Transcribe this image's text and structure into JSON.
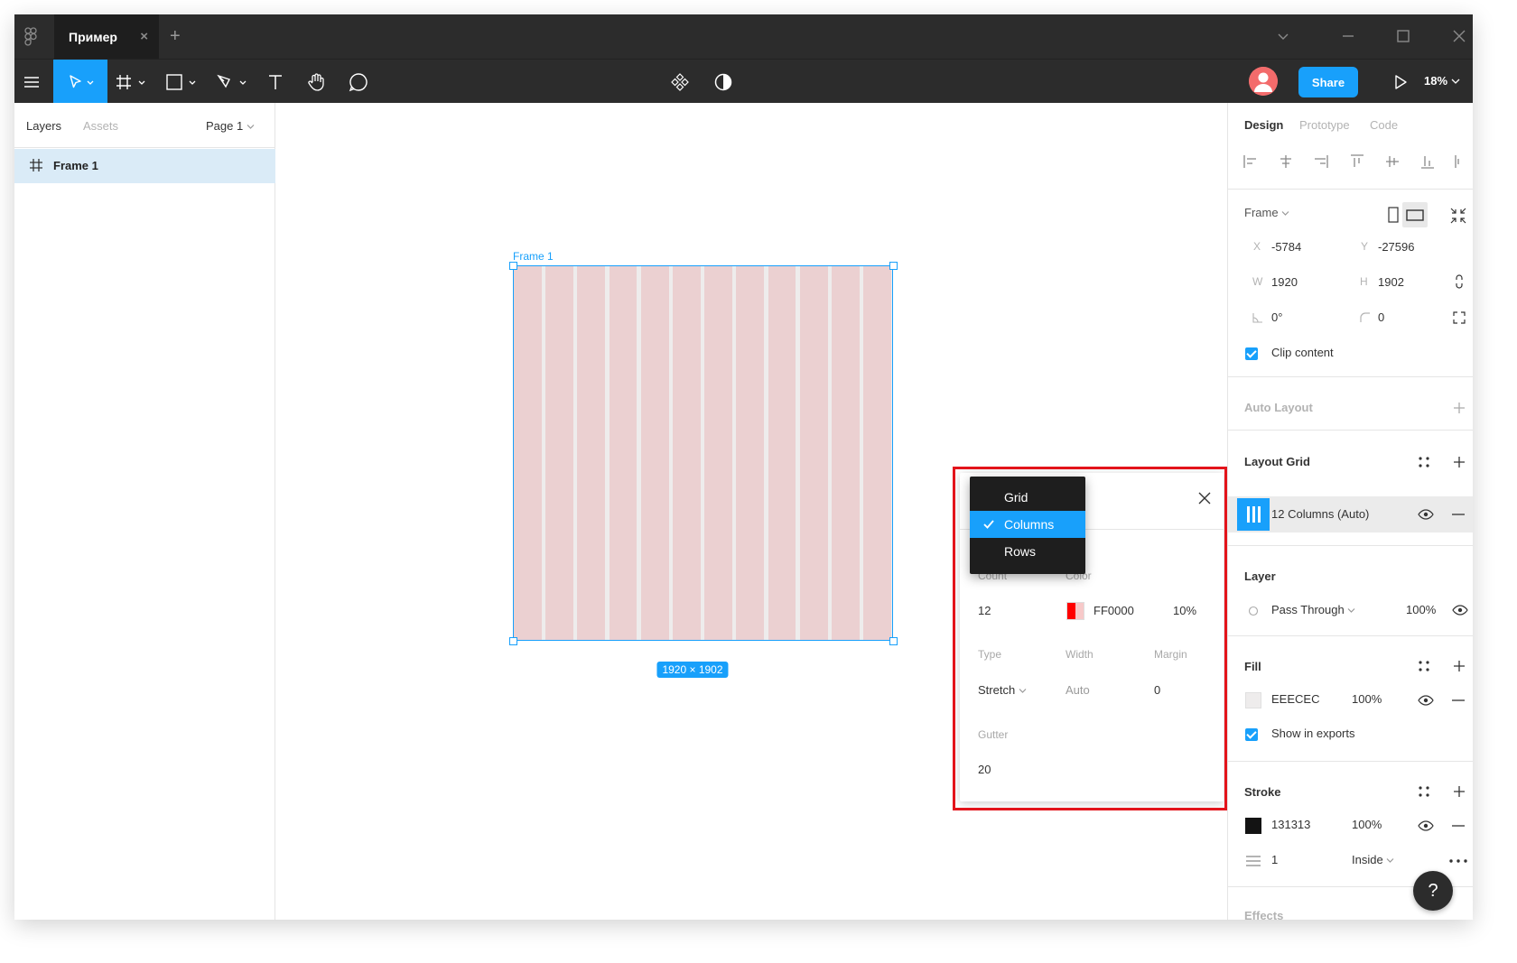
{
  "titlebar": {
    "tab_name": "Пример",
    "tab_close": "×",
    "add_tab": "+"
  },
  "toolbar": {
    "share_label": "Share",
    "zoom": "18%"
  },
  "left_panel": {
    "tabs": [
      "Layers",
      "Assets"
    ],
    "page": "Page 1",
    "layers": [
      {
        "name": "Frame 1"
      }
    ]
  },
  "canvas": {
    "frame_label": "Frame 1",
    "size_badge": "1920 × 1902",
    "column_count": 12
  },
  "grid_popup": {
    "count_label": "Count",
    "color_label": "Color",
    "count": "12",
    "color_hex": "FF0000",
    "opacity": "10%",
    "type_label": "Type",
    "width_label": "Width",
    "margin_label": "Margin",
    "type": "Stretch",
    "width": "Auto",
    "margin": "0",
    "gutter_label": "Gutter",
    "gutter": "20"
  },
  "grid_dropdown": {
    "items": [
      "Grid",
      "Columns",
      "Rows"
    ],
    "selected": "Columns"
  },
  "right_panel": {
    "tabs": [
      "Design",
      "Prototype",
      "Code"
    ],
    "frame_label": "Frame",
    "x_label": "X",
    "x": "-5784",
    "y_label": "Y",
    "y": "-27596",
    "w_label": "W",
    "w": "1920",
    "h_label": "H",
    "h": "1902",
    "rotation": "0°",
    "radius": "0",
    "clip_content": "Clip content",
    "auto_layout": "Auto Layout",
    "layout_grid": "Layout Grid",
    "grid_item": "12 Columns (Auto)",
    "layer": "Layer",
    "blend": "Pass Through",
    "layer_opacity": "100%",
    "fill": "Fill",
    "fill_hex": "EEECEC",
    "fill_opacity": "100%",
    "show_exports": "Show in exports",
    "stroke": "Stroke",
    "stroke_hex": "131313",
    "stroke_opacity": "100%",
    "stroke_width": "1",
    "stroke_align": "Inside",
    "effects": "Effects"
  },
  "help": "?",
  "colors": {
    "accent": "#18a0fb",
    "toolbar_bg": "#2c2c2c",
    "grid_color": "#ff0000",
    "highlight": "#e3141b",
    "fill": "#eeecec",
    "stroke": "#131313"
  }
}
